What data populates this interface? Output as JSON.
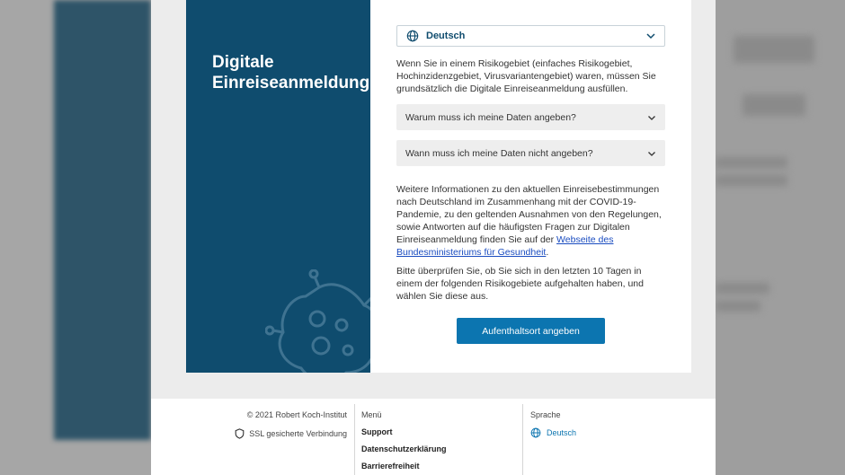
{
  "brand": {
    "title_line1": "Digitale",
    "title_line2": "Einreiseanmeldung"
  },
  "language_select": {
    "value": "Deutsch",
    "icon": "globe-icon"
  },
  "intro": "Wenn Sie in einem Risikogebiet (einfaches Risikogebiet, Hochinzidenzgebiet, Virusvariantengebiet) waren, müssen Sie grundsätzlich die Digitale Einreiseanmeldung ausfüllen.",
  "accordions": [
    {
      "label": "Warum muss ich meine Daten angeben?"
    },
    {
      "label": "Wann muss ich meine Daten nicht angeben?"
    }
  ],
  "info": {
    "text": "Weitere Informationen zu den aktuellen Einreisebestimmungen nach Deutschland im Zusammenhang mit der COVID-19-Pandemie, zu den geltenden Ausnahmen von den Regelungen, sowie Antworten auf die häufigsten Fragen zur Digitalen Einreiseanmeldung finden Sie auf der ",
    "link": "Webseite des Bundesministeriums für Gesundheit",
    "suffix": "."
  },
  "check": "Bitte überprüfen Sie, ob Sie sich in den letzten 10 Tagen in einem der folgenden Risikogebiete aufgehalten haben, und wählen Sie diese aus.",
  "cta": "Aufenthaltsort angeben",
  "footer": {
    "copyright": "© 2021 Robert Koch-Institut",
    "ssl": "SSL gesicherte Verbindung",
    "menu_head": "Menü",
    "menu_items": [
      "Support",
      "Datenschutzerklärung",
      "Barrierefreiheit"
    ],
    "lang_head": "Sprache",
    "lang_value": "Deutsch"
  },
  "colors": {
    "brand": "#0f4c6e",
    "button": "#0c75b0",
    "link": "#1a4cc0"
  }
}
